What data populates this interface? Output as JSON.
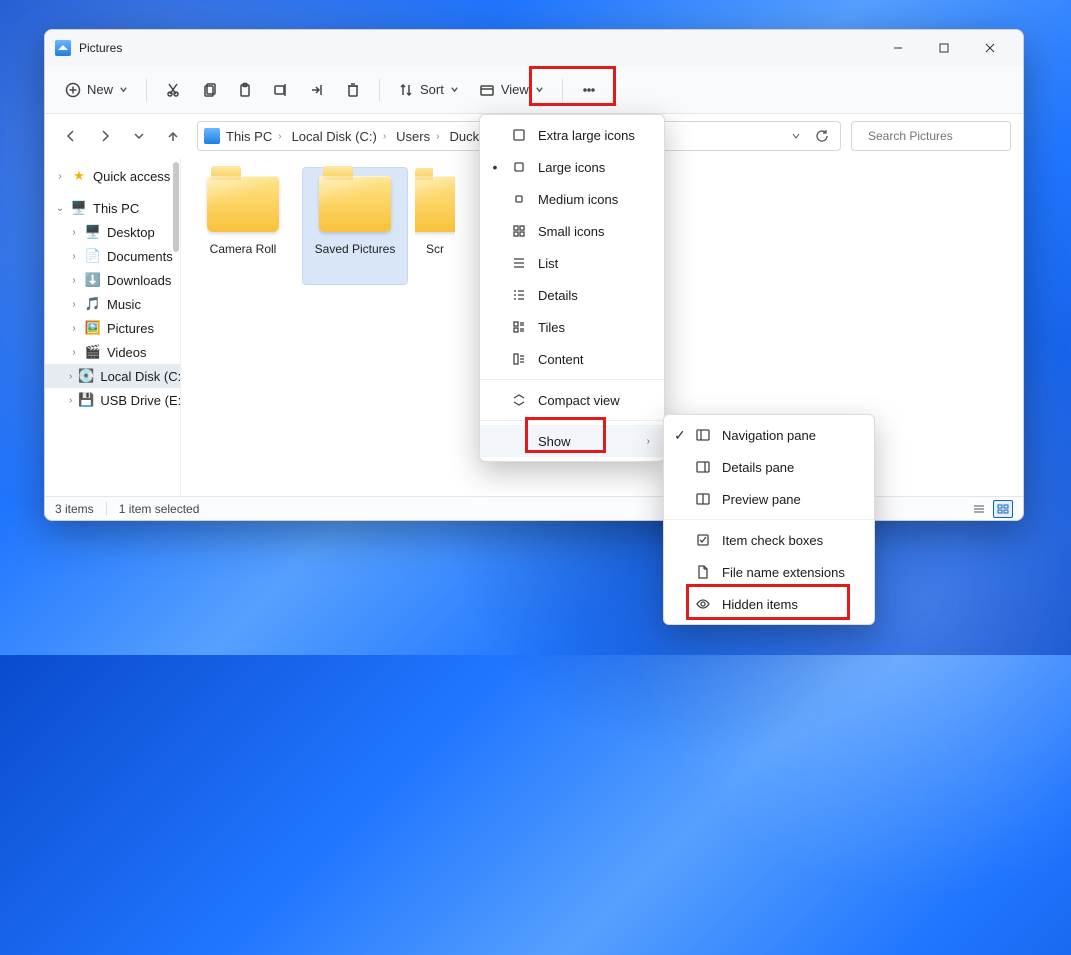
{
  "window": {
    "title": "Pictures"
  },
  "toolbar": {
    "new_label": "New",
    "sort_label": "Sort",
    "view_label": "View"
  },
  "breadcrumbs": [
    "This PC",
    "Local Disk (C:)",
    "Users",
    "Ducklor"
  ],
  "search": {
    "placeholder": "Search Pictures"
  },
  "sidebar": {
    "quick_access": "Quick access",
    "this_pc": "This PC",
    "desktop": "Desktop",
    "documents": "Documents",
    "downloads": "Downloads",
    "music": "Music",
    "pictures": "Pictures",
    "videos": "Videos",
    "local_disk": "Local Disk (C:)",
    "usb_drive": "USB Drive (E:)"
  },
  "folders": [
    "Camera Roll",
    "Saved Pictures",
    "Scr"
  ],
  "statusbar": {
    "count": "3 items",
    "selected": "1 item selected"
  },
  "view_menu": {
    "extra_large": "Extra large icons",
    "large": "Large icons",
    "medium": "Medium icons",
    "small": "Small icons",
    "list": "List",
    "details": "Details",
    "tiles": "Tiles",
    "content": "Content",
    "compact": "Compact view",
    "show": "Show"
  },
  "show_menu": {
    "navigation_pane": "Navigation pane",
    "details_pane": "Details pane",
    "preview_pane": "Preview pane",
    "item_check_boxes": "Item check boxes",
    "file_name_extensions": "File name extensions",
    "hidden_items": "Hidden items"
  }
}
